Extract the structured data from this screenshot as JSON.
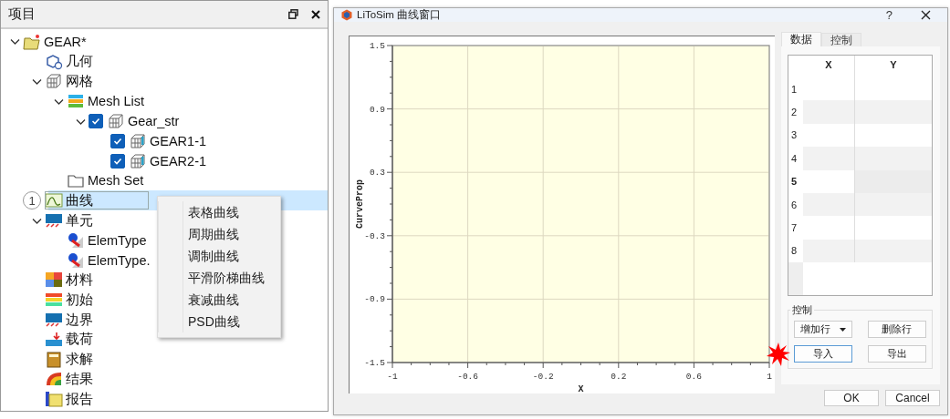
{
  "project_panel": {
    "title": "项目",
    "tree": [
      {
        "label": "GEAR*",
        "kind": "project",
        "expanded": true,
        "selected": false,
        "children": [
          {
            "label": "几何",
            "kind": "geometry",
            "selected": false
          },
          {
            "label": "网格",
            "kind": "mesh",
            "expanded": true,
            "selected": false,
            "children": [
              {
                "label": "Mesh List",
                "kind": "mesh-list",
                "expanded": true,
                "selected": false,
                "children": [
                  {
                    "label": "Gear_str",
                    "kind": "mesh",
                    "expanded": true,
                    "checked": true,
                    "selected": false,
                    "children": [
                      {
                        "label": "GEAR1-1",
                        "kind": "mesh-part",
                        "checked": true,
                        "selected": false
                      },
                      {
                        "label": "GEAR2-1",
                        "kind": "mesh-part",
                        "checked": true,
                        "selected": false
                      }
                    ]
                  }
                ]
              },
              {
                "label": "Mesh Set",
                "kind": "mesh-set",
                "selected": false
              }
            ]
          },
          {
            "label": "曲线",
            "kind": "curve",
            "selected": true,
            "marker": "1"
          },
          {
            "label": "单元",
            "kind": "element",
            "expanded": true,
            "selected": false,
            "children": [
              {
                "label": "ElemType",
                "kind": "elemtype",
                "selected": false
              },
              {
                "label": "ElemType.",
                "kind": "elemtype",
                "selected": false
              }
            ]
          },
          {
            "label": "材料",
            "kind": "material",
            "selected": false
          },
          {
            "label": "初始",
            "kind": "initial",
            "selected": false
          },
          {
            "label": "边界",
            "kind": "element",
            "selected": false
          },
          {
            "label": "载荷",
            "kind": "load",
            "selected": false
          },
          {
            "label": "求解",
            "kind": "solve",
            "selected": false
          },
          {
            "label": "结果",
            "kind": "result",
            "selected": false
          },
          {
            "label": "报告",
            "kind": "report",
            "selected": false
          }
        ]
      }
    ],
    "context_menu": {
      "items": [
        {
          "label": "表格曲线"
        },
        {
          "label": "周期曲线"
        },
        {
          "label": "调制曲线"
        },
        {
          "label": "平滑阶梯曲线"
        },
        {
          "label": "衰减曲线"
        },
        {
          "label": "PSD曲线"
        }
      ]
    }
  },
  "dialog": {
    "title": "LiToSim 曲线窗口",
    "help": "?",
    "chart_data": {
      "type": "line",
      "grid": true,
      "xlabel": "X",
      "ylabel": "CurveProp",
      "xlim": [
        -1,
        1
      ],
      "ylim": [
        -1.5,
        1.5
      ],
      "xticks": [
        -1,
        -0.6,
        -0.2,
        0.2,
        0.6,
        1
      ],
      "yticks": [
        -1.5,
        -0.9,
        -0.3,
        0.3,
        0.9,
        1.5
      ]
    },
    "tabs": [
      {
        "label": "数据",
        "selected": true
      },
      {
        "label": "控制",
        "selected": false
      }
    ],
    "table": {
      "columns": [
        "X",
        "Y"
      ],
      "rows": [
        {
          "label": "1",
          "current": false
        },
        {
          "label": "2",
          "current": false
        },
        {
          "label": "3",
          "current": false
        },
        {
          "label": "4",
          "current": false
        },
        {
          "label": "5",
          "current": true
        },
        {
          "label": "6",
          "current": false
        },
        {
          "label": "7",
          "current": false
        },
        {
          "label": "8",
          "current": false
        }
      ]
    },
    "control_group": {
      "title": "控制",
      "buttons": [
        {
          "label": "增加行",
          "kind": "dropdown",
          "focused": false
        },
        {
          "label": "删除行",
          "kind": "plain",
          "focused": false
        },
        {
          "label": "导入",
          "kind": "plain",
          "focused": true,
          "highlight": true
        },
        {
          "label": "导出",
          "kind": "plain",
          "focused": false
        }
      ]
    },
    "footer_buttons": [
      "OK",
      "Cancel"
    ]
  }
}
